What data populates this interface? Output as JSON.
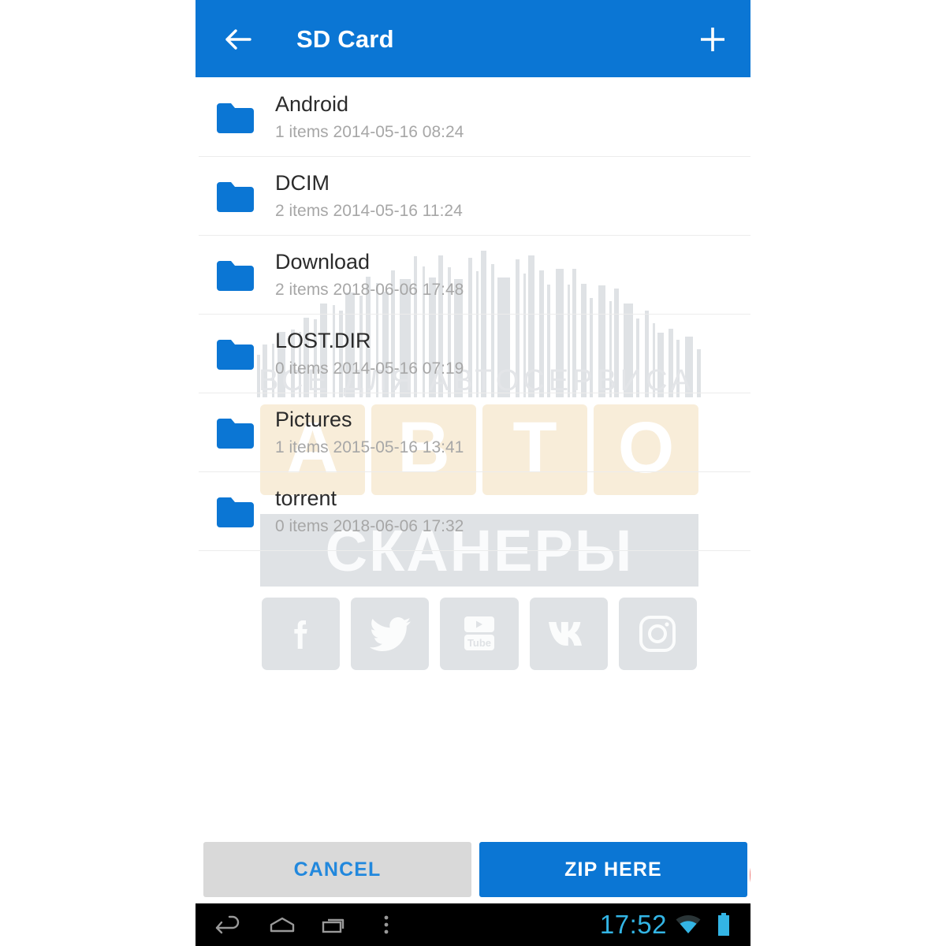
{
  "appbar": {
    "title": "SD Card",
    "back_icon": "arrow-back-icon",
    "add_icon": "plus-icon"
  },
  "list": {
    "items": [
      {
        "name": "Android",
        "meta": "1 items 2014-05-16 08:24",
        "icon": "folder-icon"
      },
      {
        "name": "DCIM",
        "meta": "2 items 2014-05-16 11:24",
        "icon": "folder-icon"
      },
      {
        "name": "Download",
        "meta": "2 items 2018-06-06 17:48",
        "icon": "folder-icon"
      },
      {
        "name": "LOST.DIR",
        "meta": "0 items 2014-05-16 07:19",
        "icon": "folder-icon"
      },
      {
        "name": "Pictures",
        "meta": "1 items 2015-05-16 13:41",
        "icon": "folder-icon"
      },
      {
        "name": "torrent",
        "meta": "0 items 2018-06-06 17:32",
        "icon": "folder-icon"
      }
    ]
  },
  "buttons": {
    "cancel_label": "CANCEL",
    "zip_label": "ZIP HERE"
  },
  "watermark": {
    "tagline": "ВСЕ ДЛЯ АВТОСЕРВИСА",
    "word_tiles": [
      "А",
      "В",
      "Т",
      "О"
    ],
    "band_text": "СКАНЕРЫ",
    "social": [
      "facebook-icon",
      "twitter-icon",
      "youtube-icon",
      "vk-icon",
      "instagram-icon"
    ]
  },
  "navbar": {
    "time": "17:52",
    "back_icon": "nav-back-icon",
    "home_icon": "nav-home-icon",
    "recents_icon": "nav-recents-icon",
    "menu_icon": "nav-overflow-icon",
    "wifi_icon": "wifi-icon",
    "battery_icon": "battery-icon"
  },
  "annotation": {
    "shape": "red-ellipse-highlight",
    "color": "#e8524f"
  },
  "colors": {
    "accent_blue": "#0b76d4",
    "cancel_gray": "#d9d9d9",
    "status_cyan": "#33b5e5",
    "watermark_gray": "#dfe2e5",
    "watermark_cream": "#f8edd9"
  }
}
